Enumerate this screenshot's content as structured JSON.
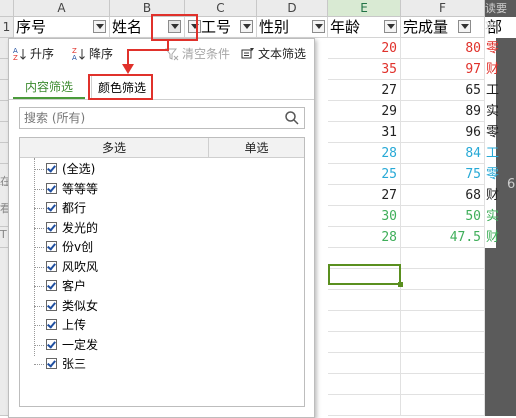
{
  "columns": [
    "A",
    "B",
    "C",
    "D",
    "E",
    "F"
  ],
  "headers": {
    "row_num": "1",
    "A": "序号",
    "B": "姓名",
    "C": "工号",
    "D": "性别",
    "E": "年龄",
    "F": "完成量",
    "G": "部"
  },
  "rows": [
    {
      "age": "20",
      "qty": "80",
      "extra": "零",
      "color": "#e0312b"
    },
    {
      "age": "35",
      "qty": "97",
      "extra": "财",
      "color": "#e0312b"
    },
    {
      "age": "27",
      "qty": "65",
      "extra": "工",
      "color": "#222222"
    },
    {
      "age": "29",
      "qty": "89",
      "extra": "实",
      "color": "#222222"
    },
    {
      "age": "31",
      "qty": "96",
      "extra": "零",
      "color": "#222222"
    },
    {
      "age": "28",
      "qty": "84",
      "extra": "工",
      "color": "#27a9d6"
    },
    {
      "age": "25",
      "qty": "75",
      "extra": "零",
      "color": "#27a9d6"
    },
    {
      "age": "27",
      "qty": "68",
      "extra": "财",
      "color": "#222222"
    },
    {
      "age": "30",
      "qty": "50",
      "extra": "实",
      "color": "#3fae5a"
    },
    {
      "age": "28",
      "qty": "47.5",
      "extra": "财",
      "color": "#3fae5a"
    }
  ],
  "left_fragments": [
    "在",
    "看",
    "T"
  ],
  "right_fragments": [
    "读要求",
    "6"
  ],
  "toolbar": {
    "sort_asc": "升序",
    "sort_desc": "降序",
    "clear": "清空条件",
    "text_filter": "文本筛选"
  },
  "tabs": {
    "content": "内容筛选",
    "color": "颜色筛选"
  },
  "search": {
    "placeholder": "搜索 (所有)"
  },
  "list_headers": {
    "multi": "多选",
    "single": "单选"
  },
  "items": [
    "(全选)",
    "等等等",
    "都行",
    "发光的",
    "份v创",
    "风吹风",
    "客户",
    "类似女",
    "上传",
    "一定发",
    "张三"
  ],
  "colors": {
    "accent_green": "#4a9a3a",
    "highlight_red": "#e0312b"
  }
}
